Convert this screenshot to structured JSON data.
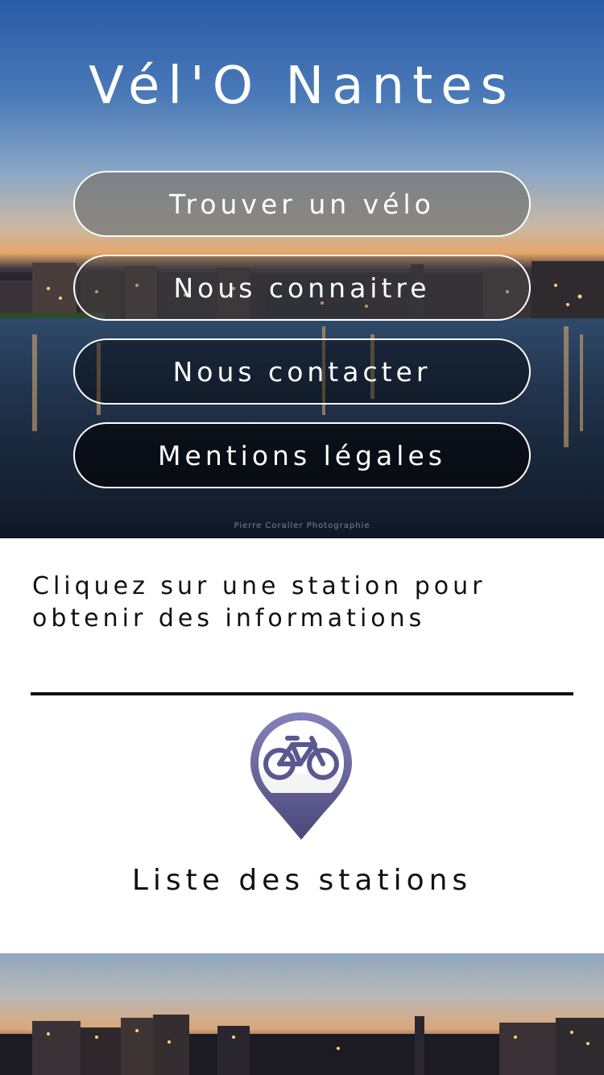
{
  "app": {
    "title": "Vél'O Nantes"
  },
  "hero": {
    "photo_credit": "Pierre Coraller Photographie"
  },
  "menu": {
    "find_bike": "Trouver un vélo",
    "about": "Nous connaitre",
    "contact": "Nous contacter",
    "legal": "Mentions légales"
  },
  "info": {
    "instruction": "Cliquez sur une station pour obtenir des informations"
  },
  "stations": {
    "icon": "bike-station-pin-icon",
    "label": "Liste des stations",
    "pin_color": "#5a5890",
    "pin_light": "#7e7cb4"
  }
}
